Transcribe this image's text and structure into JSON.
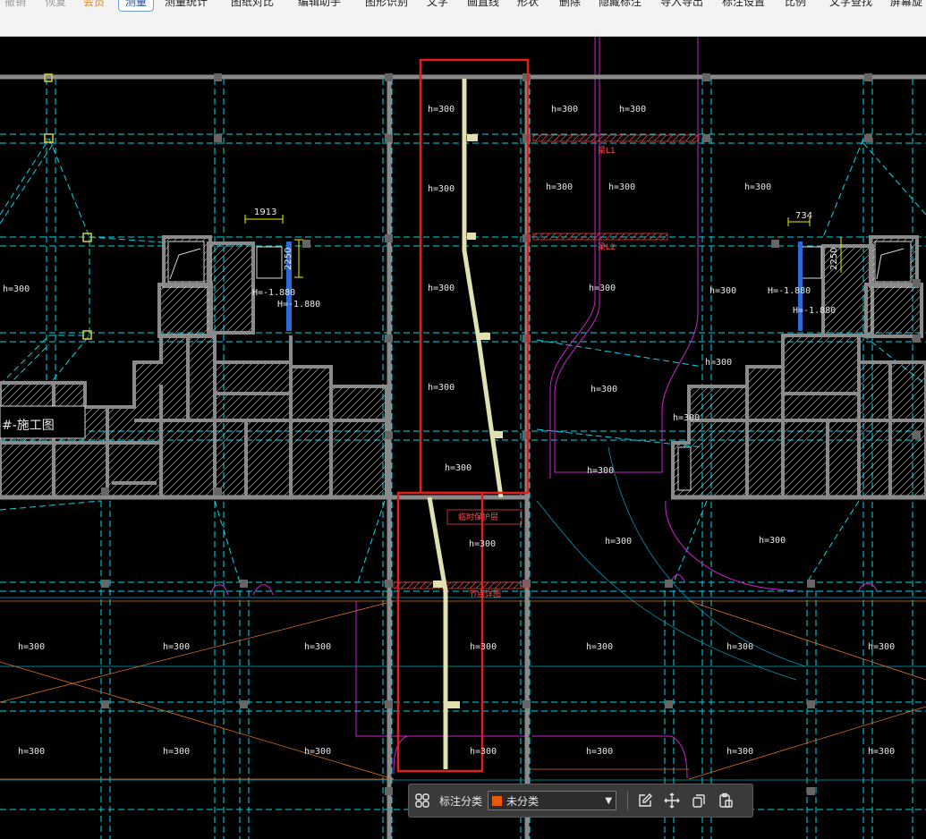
{
  "toolbar": {
    "items": [
      {
        "label": "撤销",
        "state": "disabled"
      },
      {
        "label": "恢复",
        "state": "disabled"
      },
      {
        "label": "会员",
        "state": "vip"
      },
      {
        "label": "测量",
        "state": "active"
      },
      {
        "label": "测量统计",
        "state": "normal"
      },
      {
        "label": "图纸对比",
        "state": "normal"
      },
      {
        "label": "编辑助手",
        "state": "normal"
      },
      {
        "label": "图形识别",
        "state": "normal"
      },
      {
        "label": "文字",
        "state": "normal"
      },
      {
        "label": "画直线",
        "state": "normal"
      },
      {
        "label": "形状",
        "state": "normal"
      },
      {
        "label": "删除",
        "state": "normal"
      },
      {
        "label": "隐藏标注",
        "state": "normal"
      },
      {
        "label": "导入导出",
        "state": "normal"
      },
      {
        "label": "标注设置",
        "state": "normal"
      },
      {
        "label": "比例",
        "state": "normal"
      },
      {
        "label": "文字查找",
        "state": "normal"
      },
      {
        "label": "屏幕旋",
        "state": "normal"
      }
    ]
  },
  "drawing": {
    "room_label": "h=300",
    "dims": {
      "d1913": "1913",
      "d2250a": "2250",
      "d2250b": "2250",
      "d734": "734",
      "h1": "H=-1.880",
      "h2": "H=-1.880",
      "h3": "H=-1.880",
      "h4": "H=-1.880"
    },
    "plan_title": "#-施工图",
    "beam_tag_1": "梁L1",
    "beam_tag_2": "梁L2",
    "note_1": "临时保护层",
    "note_2": "节点详图"
  },
  "annotation_bar": {
    "category_label": "标注分类",
    "category_value": "未分类",
    "swatch_color": "#e8590c",
    "icons": [
      "grid-icon",
      "edit-icon",
      "move-icon",
      "copy-icon",
      "paste-icon"
    ]
  },
  "colors": {
    "highlight": "#e02020",
    "axis": "#00d8e6",
    "wall": "#8a8a8a",
    "magenta": "#d020d0",
    "orange": "#e07020"
  }
}
